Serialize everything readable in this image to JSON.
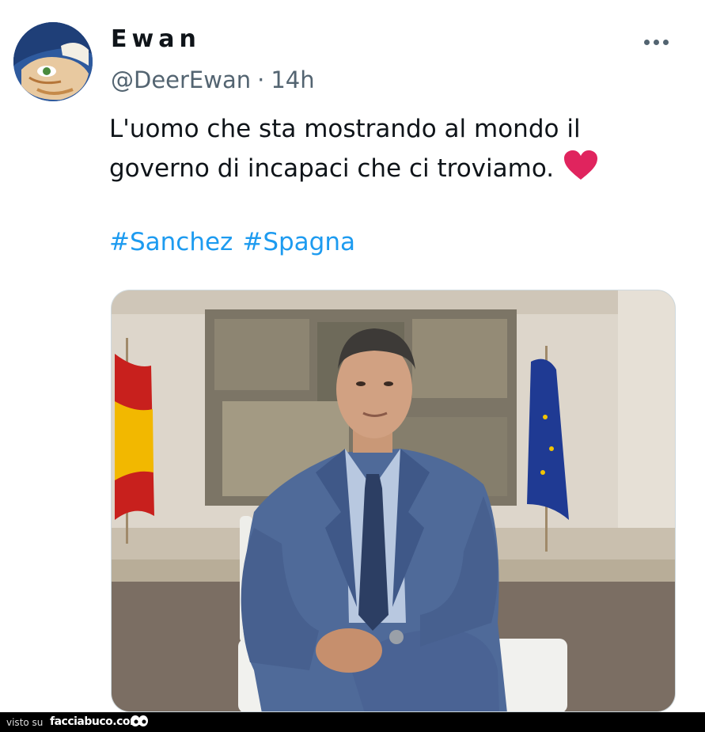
{
  "tweet": {
    "author_name": "Ewan",
    "handle": "@DeerEwan",
    "separator": "·",
    "time": "14h",
    "text_line1": "L'uomo che sta mostrando al mondo il",
    "text_line2": "governo di incapaci che ci troviamo.",
    "hashtags": [
      "#Sanchez",
      "#Spagna"
    ],
    "more_icon": "more-horizontal-icon",
    "emoji": "red-heart-icon"
  },
  "colors": {
    "text": "#0f1419",
    "secondary": "#536471",
    "link": "#1d9bf0",
    "heart": "#e0245e"
  },
  "footer": {
    "prefix": "visto su",
    "brand": "facciabuco.com"
  }
}
